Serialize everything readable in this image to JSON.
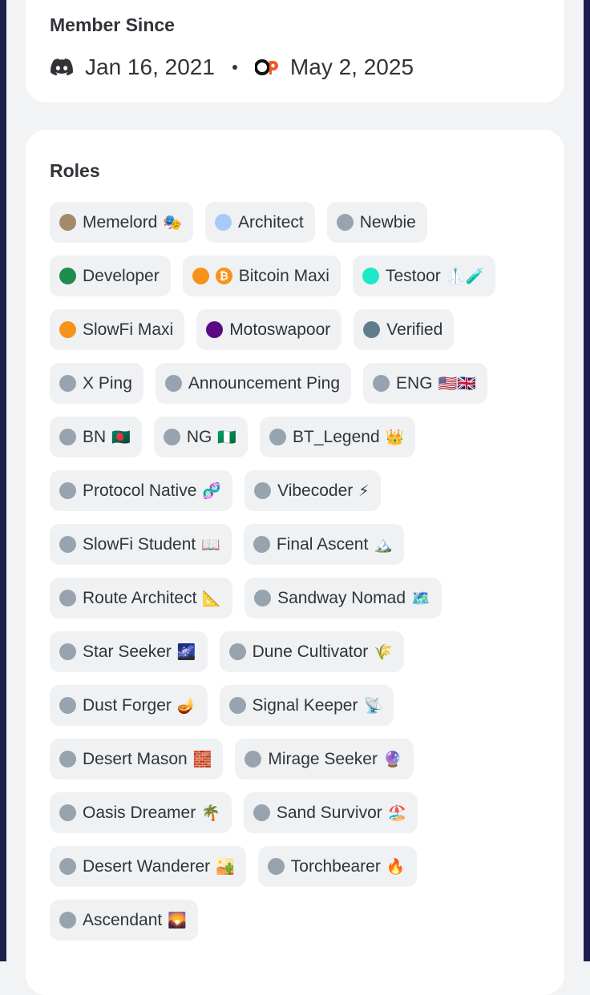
{
  "member_since": {
    "title": "Member Since",
    "discord_date": "Jan 16, 2021",
    "other_date": "May 2, 2025",
    "discord_icon": "discord-icon",
    "other_icon": "op-logo-icon"
  },
  "roles": {
    "title": "Roles",
    "items": [
      {
        "label": "Memelord",
        "emoji": "🎭",
        "color": "#a28a6a"
      },
      {
        "label": "Architect",
        "emoji": "",
        "color": "#a9c9fb"
      },
      {
        "label": "Newbie",
        "emoji": "",
        "color": "#97a3ae"
      },
      {
        "label": "Developer",
        "emoji": "",
        "color": "#1f8b4c"
      },
      {
        "label": "Bitcoin Maxi",
        "emoji": "",
        "color": "#f7931a",
        "prefix_icon": "bitcoin-icon",
        "prefix_text": "₿"
      },
      {
        "label": "Testoor",
        "emoji": "🥼🧪",
        "color": "#1de9c6"
      },
      {
        "label": "SlowFi Maxi",
        "emoji": "",
        "color": "#f7931a"
      },
      {
        "label": "Motoswapoor",
        "emoji": "",
        "color": "#5b0a84"
      },
      {
        "label": "Verified",
        "emoji": "",
        "color": "#607d8b"
      },
      {
        "label": "X Ping",
        "emoji": "",
        "color": "#97a3ae"
      },
      {
        "label": "Announcement Ping",
        "emoji": "",
        "color": "#97a3ae"
      },
      {
        "label": "ENG",
        "emoji": "🇺🇸🇬🇧",
        "color": "#97a3ae"
      },
      {
        "label": "BN",
        "emoji": "🇧🇩",
        "color": "#97a3ae"
      },
      {
        "label": "NG",
        "emoji": "🇳🇬",
        "color": "#97a3ae"
      },
      {
        "label": "BT_Legend",
        "emoji": "👑",
        "color": "#97a3ae"
      },
      {
        "label": "Protocol Native",
        "emoji": "🧬",
        "color": "#97a3ae"
      },
      {
        "label": "Vibecoder",
        "emoji": "⚡",
        "color": "#97a3ae"
      },
      {
        "label": "SlowFi Student",
        "emoji": "📖",
        "color": "#97a3ae"
      },
      {
        "label": "Final Ascent",
        "emoji": "🏔️",
        "color": "#97a3ae"
      },
      {
        "label": "Route Architect",
        "emoji": "📐",
        "color": "#97a3ae"
      },
      {
        "label": "Sandway Nomad",
        "emoji": "🗺️",
        "color": "#97a3ae"
      },
      {
        "label": "Star Seeker",
        "emoji": "🌌",
        "color": "#97a3ae"
      },
      {
        "label": "Dune Cultivator",
        "emoji": "🌾",
        "color": "#97a3ae"
      },
      {
        "label": "Dust Forger",
        "emoji": "🪔",
        "color": "#97a3ae"
      },
      {
        "label": "Signal Keeper",
        "emoji": "📡",
        "color": "#97a3ae"
      },
      {
        "label": "Desert Mason",
        "emoji": "🧱",
        "color": "#97a3ae"
      },
      {
        "label": "Mirage Seeker",
        "emoji": "🔮",
        "color": "#97a3ae"
      },
      {
        "label": "Oasis Dreamer",
        "emoji": "🌴",
        "color": "#97a3ae"
      },
      {
        "label": "Sand Survivor",
        "emoji": "🏖️",
        "color": "#97a3ae"
      },
      {
        "label": "Desert Wanderer",
        "emoji": "🏜️",
        "color": "#97a3ae"
      },
      {
        "label": "Torchbearer",
        "emoji": "🔥",
        "color": "#97a3ae"
      },
      {
        "label": "Ascendant",
        "emoji": "🌄",
        "color": "#97a3ae"
      }
    ]
  }
}
